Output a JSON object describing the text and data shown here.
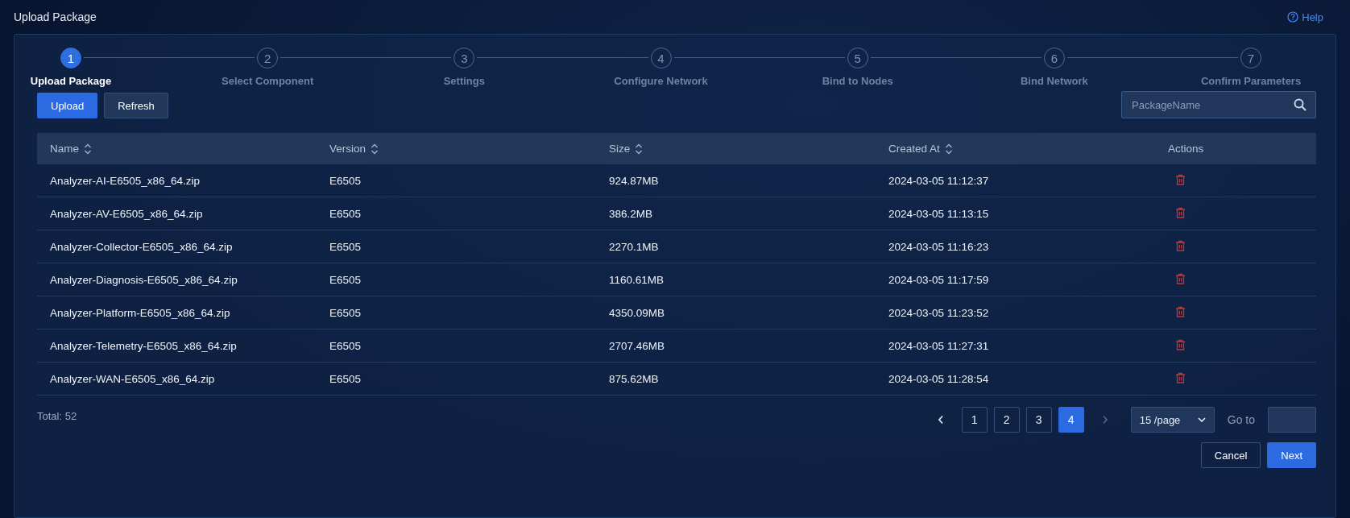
{
  "page": {
    "title": "Upload Package",
    "help": "Help"
  },
  "steps": [
    {
      "number": "1",
      "label": "Upload Package",
      "selected": true
    },
    {
      "number": "2",
      "label": "Select Component",
      "selected": false
    },
    {
      "number": "3",
      "label": "Settings",
      "selected": false
    },
    {
      "number": "4",
      "label": "Configure Network",
      "selected": false
    },
    {
      "number": "5",
      "label": "Bind to Nodes",
      "selected": false
    },
    {
      "number": "6",
      "label": "Bind Network",
      "selected": false
    },
    {
      "number": "7",
      "label": "Confirm Parameters",
      "selected": false
    }
  ],
  "toolbar": {
    "buttons": [
      {
        "label": "Upload",
        "kind": "primary"
      },
      {
        "label": "Refresh",
        "kind": "secondary"
      }
    ],
    "search": {
      "placeholder": "PackageName"
    }
  },
  "table": {
    "columns": [
      {
        "label": "Name",
        "sortable": true
      },
      {
        "label": "Version",
        "sortable": true
      },
      {
        "label": "Size",
        "sortable": true
      },
      {
        "label": "Created At",
        "sortable": true
      },
      {
        "label": "Actions",
        "sortable": false
      }
    ],
    "rows": [
      [
        "Analyzer-AI-E6505_x86_64.zip",
        "E6505",
        "924.87MB",
        "2024-03-05 11:12:37"
      ],
      [
        "Analyzer-AV-E6505_x86_64.zip",
        "E6505",
        "386.2MB",
        "2024-03-05 11:13:15"
      ],
      [
        "Analyzer-Collector-E6505_x86_64.zip",
        "E6505",
        "2270.1MB",
        "2024-03-05 11:16:23"
      ],
      [
        "Analyzer-Diagnosis-E6505_x86_64.zip",
        "E6505",
        "1160.61MB",
        "2024-03-05 11:17:59"
      ],
      [
        "Analyzer-Platform-E6505_x86_64.zip",
        "E6505",
        "4350.09MB",
        "2024-03-05 11:23:52"
      ],
      [
        "Analyzer-Telemetry-E6505_x86_64.zip",
        "E6505",
        "2707.46MB",
        "2024-03-05 11:27:31"
      ],
      [
        "Analyzer-WAN-E6505_x86_64.zip",
        "E6505",
        "875.62MB",
        "2024-03-05 11:28:54"
      ]
    ]
  },
  "pagination": {
    "total": "Total: 52",
    "pages": [
      {
        "label": "1",
        "selected": false
      },
      {
        "label": "2",
        "selected": false
      },
      {
        "label": "3",
        "selected": false
      },
      {
        "label": "4",
        "selected": true
      }
    ],
    "prev_disabled": false,
    "next_disabled": true,
    "page_size": "15 /page",
    "goto_label": "Go to"
  },
  "footer": {
    "buttons": [
      {
        "label": "Cancel",
        "kind": "secondary"
      },
      {
        "label": "Next",
        "kind": "primary"
      }
    ]
  }
}
